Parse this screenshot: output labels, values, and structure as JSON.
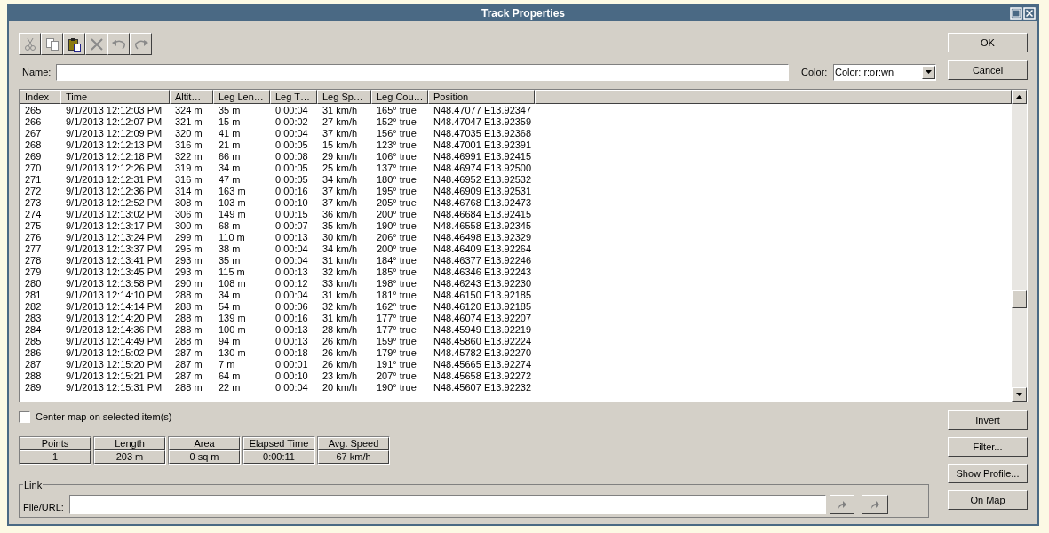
{
  "window": {
    "title": "Track Properties"
  },
  "toolbar": [
    {
      "kind": "cut",
      "disabled": true
    },
    {
      "kind": "copy",
      "disabled": true
    },
    {
      "kind": "paste",
      "disabled": false
    },
    {
      "kind": "delete",
      "disabled": true
    },
    {
      "kind": "undo",
      "disabled": true
    },
    {
      "kind": "redo",
      "disabled": true
    }
  ],
  "name_field": {
    "label": "Name:"
  },
  "color_field": {
    "label": "Color:",
    "value": "Color: r:or:wn"
  },
  "buttons_top": [
    "OK",
    "Cancel"
  ],
  "table": {
    "columns": [
      "Index",
      "Time",
      "Altit…",
      "Leg Len…",
      "Leg T…",
      "Leg Sp…",
      "Leg Cou…",
      "Position"
    ],
    "rows": [
      [
        "265",
        "9/1/2013 12:12:03 PM",
        "324 m",
        "35 m",
        "0:00:04",
        "31 km/h",
        "165° true",
        "N48.47077 E13.92347"
      ],
      [
        "266",
        "9/1/2013 12:12:07 PM",
        "321 m",
        "15 m",
        "0:00:02",
        "27 km/h",
        "152° true",
        "N48.47047 E13.92359"
      ],
      [
        "267",
        "9/1/2013 12:12:09 PM",
        "320 m",
        "41 m",
        "0:00:04",
        "37 km/h",
        "156° true",
        "N48.47035 E13.92368"
      ],
      [
        "268",
        "9/1/2013 12:12:13 PM",
        "316 m",
        "21 m",
        "0:00:05",
        "15 km/h",
        "123° true",
        "N48.47001 E13.92391"
      ],
      [
        "269",
        "9/1/2013 12:12:18 PM",
        "322 m",
        "66 m",
        "0:00:08",
        "29 km/h",
        "106° true",
        "N48.46991 E13.92415"
      ],
      [
        "270",
        "9/1/2013 12:12:26 PM",
        "319 m",
        "34 m",
        "0:00:05",
        "25 km/h",
        "137° true",
        "N48.46974 E13.92500"
      ],
      [
        "271",
        "9/1/2013 12:12:31 PM",
        "316 m",
        "47 m",
        "0:00:05",
        "34 km/h",
        "180° true",
        "N48.46952 E13.92532"
      ],
      [
        "272",
        "9/1/2013 12:12:36 PM",
        "314 m",
        "163 m",
        "0:00:16",
        "37 km/h",
        "195° true",
        "N48.46909 E13.92531"
      ],
      [
        "273",
        "9/1/2013 12:12:52 PM",
        "308 m",
        "103 m",
        "0:00:10",
        "37 km/h",
        "205° true",
        "N48.46768 E13.92473"
      ],
      [
        "274",
        "9/1/2013 12:13:02 PM",
        "306 m",
        "149 m",
        "0:00:15",
        "36 km/h",
        "200° true",
        "N48.46684 E13.92415"
      ],
      [
        "275",
        "9/1/2013 12:13:17 PM",
        "300 m",
        "68 m",
        "0:00:07",
        "35 km/h",
        "190° true",
        "N48.46558 E13.92345"
      ],
      [
        "276",
        "9/1/2013 12:13:24 PM",
        "299 m",
        "110 m",
        "0:00:13",
        "30 km/h",
        "206° true",
        "N48.46498 E13.92329"
      ],
      [
        "277",
        "9/1/2013 12:13:37 PM",
        "295 m",
        "38 m",
        "0:00:04",
        "34 km/h",
        "200° true",
        "N48.46409 E13.92264"
      ],
      [
        "278",
        "9/1/2013 12:13:41 PM",
        "293 m",
        "35 m",
        "0:00:04",
        "31 km/h",
        "184° true",
        "N48.46377 E13.92246"
      ],
      [
        "279",
        "9/1/2013 12:13:45 PM",
        "293 m",
        "115 m",
        "0:00:13",
        "32 km/h",
        "185° true",
        "N48.46346 E13.92243"
      ],
      [
        "280",
        "9/1/2013 12:13:58 PM",
        "290 m",
        "108 m",
        "0:00:12",
        "33 km/h",
        "198° true",
        "N48.46243 E13.92230"
      ],
      [
        "281",
        "9/1/2013 12:14:10 PM",
        "288 m",
        "34 m",
        "0:00:04",
        "31 km/h",
        "181° true",
        "N48.46150 E13.92185"
      ],
      [
        "282",
        "9/1/2013 12:14:14 PM",
        "288 m",
        "54 m",
        "0:00:06",
        "32 km/h",
        "162° true",
        "N48.46120 E13.92185"
      ],
      [
        "283",
        "9/1/2013 12:14:20 PM",
        "288 m",
        "139 m",
        "0:00:16",
        "31 km/h",
        "177° true",
        "N48.46074 E13.92207"
      ],
      [
        "284",
        "9/1/2013 12:14:36 PM",
        "288 m",
        "100 m",
        "0:00:13",
        "28 km/h",
        "177° true",
        "N48.45949 E13.92219"
      ],
      [
        "285",
        "9/1/2013 12:14:49 PM",
        "288 m",
        "94 m",
        "0:00:13",
        "26 km/h",
        "159° true",
        "N48.45860 E13.92224"
      ],
      [
        "286",
        "9/1/2013 12:15:02 PM",
        "287 m",
        "130 m",
        "0:00:18",
        "26 km/h",
        "179° true",
        "N48.45782 E13.92270"
      ],
      [
        "287",
        "9/1/2013 12:15:20 PM",
        "287 m",
        "7 m",
        "0:00:01",
        "26 km/h",
        "191° true",
        "N48.45665 E13.92274"
      ],
      [
        "288",
        "9/1/2013 12:15:21 PM",
        "287 m",
        "64 m",
        "0:00:10",
        "23 km/h",
        "207° true",
        "N48.45658 E13.92272"
      ],
      [
        "289",
        "9/1/2013 12:15:31 PM",
        "288 m",
        "22 m",
        "0:00:04",
        "20 km/h",
        "190° true",
        "N48.45607 E13.92232"
      ]
    ]
  },
  "center_checkbox": {
    "label": "Center map on selected item(s)",
    "checked": false
  },
  "stats": [
    {
      "label": "Points",
      "value": "1"
    },
    {
      "label": "Length",
      "value": "203 m"
    },
    {
      "label": "Area",
      "value": "0 sq m"
    },
    {
      "label": "Elapsed Time",
      "value": "0:00:11"
    },
    {
      "label": "Avg. Speed",
      "value": "67 km/h"
    }
  ],
  "link": {
    "title": "Link",
    "label": "File/URL:"
  },
  "buttons_side": [
    "Invert",
    "Filter...",
    "Show Profile...",
    "On Map"
  ]
}
